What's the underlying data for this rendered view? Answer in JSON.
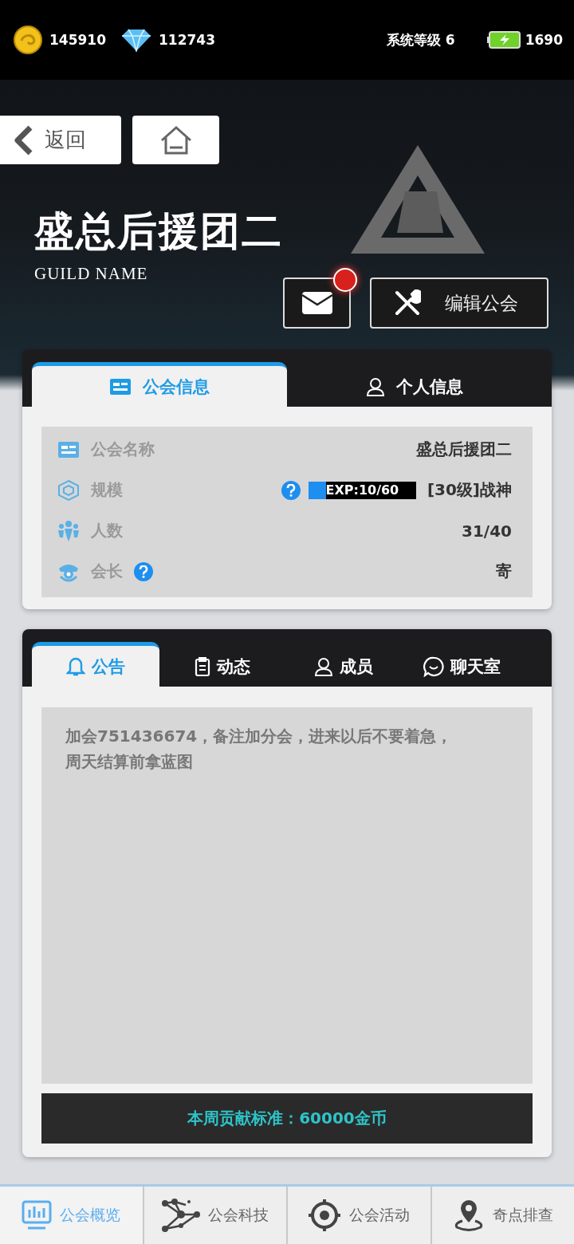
{
  "status": {
    "coins": "145910",
    "diamonds": "112743",
    "system_level": "系统等级 6",
    "energy": "1690"
  },
  "nav_buttons": {
    "back": "返回"
  },
  "guild": {
    "name": "盛总后援团二",
    "subtitle": "GUILD NAME",
    "mail_unread": true,
    "edit_button": "编辑公会"
  },
  "info_tabs": [
    {
      "label": "公会信息",
      "selected": true
    },
    {
      "label": "个人信息",
      "selected": false
    }
  ],
  "info_rows": [
    {
      "kind": "text",
      "label": "公会名称",
      "value": "盛总后援团二"
    },
    {
      "kind": "exp",
      "label": "规模",
      "exp_text": "EXP:10/60",
      "level": 0.1667,
      "value": "[30级]战神"
    },
    {
      "kind": "text",
      "label": "人数",
      "value": "31/40"
    },
    {
      "kind": "leader",
      "label": "会长",
      "value": "寄"
    }
  ],
  "board_tabs": [
    {
      "label": "公告",
      "selected": true
    },
    {
      "label": "动态",
      "selected": false
    },
    {
      "label": "成员",
      "selected": false
    },
    {
      "label": "聊天室",
      "selected": false
    }
  ],
  "notice": "加会751436674，备注加分会，进来以后不要着急，周天结算前拿蓝图",
  "contribution": "本周贡献标准：60000金币",
  "bottom_nav": [
    {
      "label": "公会概览",
      "selected": true
    },
    {
      "label": "公会科技",
      "selected": false
    },
    {
      "label": "公会活动",
      "selected": false
    },
    {
      "label": "奇点排查",
      "selected": false
    }
  ]
}
